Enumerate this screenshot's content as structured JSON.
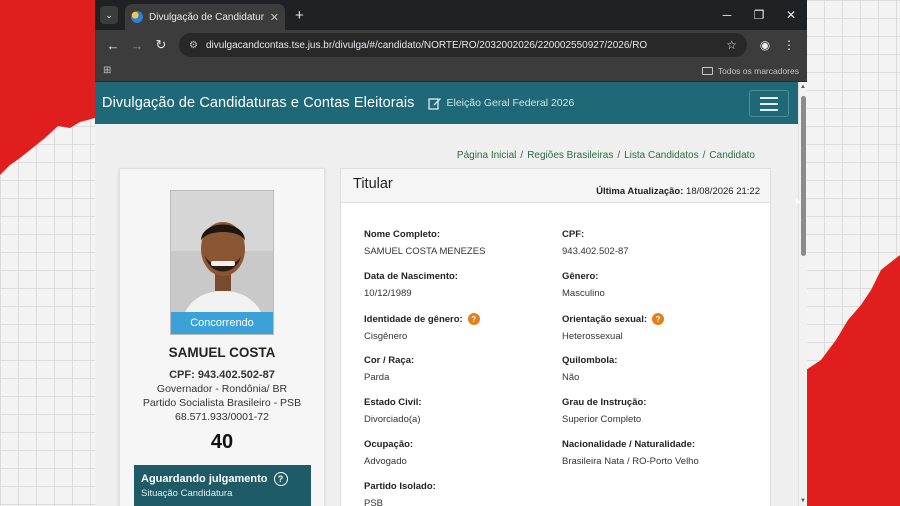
{
  "browser": {
    "tab_title": "Divulgação de Candidaturas e C",
    "url": "divulgacandcontas.tse.jus.br/divulga/#/candidato/NORTE/RO/2032002026/220002550927/2026/RO",
    "bookmarks_label": "Todos os marcadores"
  },
  "header": {
    "site_title": "Divulgação de Candidaturas e Contas Eleitorais",
    "election": "Eleição Geral Federal 2026"
  },
  "breadcrumb": [
    "Página Inicial",
    "Regiões Brasileiras",
    "Lista Candidatos",
    "Candidato"
  ],
  "candidate": {
    "status": "Concorrendo",
    "name": "SAMUEL COSTA",
    "cpf_line": "CPF: 943.402.502-87",
    "office": "Governador - Rondônia/ BR",
    "party": "Partido Socialista Brasileiro - PSB",
    "cnpj": "68.571.933/0001-72",
    "number": "40",
    "judgement_title": "Aguardando julgamento",
    "judgement_sub": "Situação Candidatura"
  },
  "details": {
    "title": "Titular",
    "updated_label": "Última Atualização:",
    "updated_value": "18/08/2026 21:22",
    "fields": [
      {
        "label": "Nome Completo:",
        "value": "SAMUEL COSTA MENEZES"
      },
      {
        "label": "CPF:",
        "value": "943.402.502-87"
      },
      {
        "label": "Data de Nascimento:",
        "value": "10/12/1989"
      },
      {
        "label": "Gênero:",
        "value": "Masculino"
      },
      {
        "label": "Identidade de gênero:",
        "value": "Cisgênero"
      },
      {
        "label": "Orientação sexual:",
        "value": "Heterossexual"
      },
      {
        "label": "Cor / Raça:",
        "value": "Parda"
      },
      {
        "label": "Quilombola:",
        "value": "Não"
      },
      {
        "label": "Estado Civil:",
        "value": "Divorciado(a)"
      },
      {
        "label": "Grau de Instrução:",
        "value": "Superior Completo"
      },
      {
        "label": "Ocupação:",
        "value": "Advogado"
      },
      {
        "label": "Nacionalidade / Naturalidade:",
        "value": "Brasileira Nata / RO-Porto Velho"
      },
      {
        "label": "Partido Isolado:",
        "value": "PSB"
      }
    ]
  },
  "colors": {
    "header_teal": "#1e6877",
    "status_blue": "#3aa2d8",
    "judgement_bg": "#1f5b66",
    "info_orange": "#e57e1d",
    "breadcrumb_green": "#2c6e3f"
  }
}
